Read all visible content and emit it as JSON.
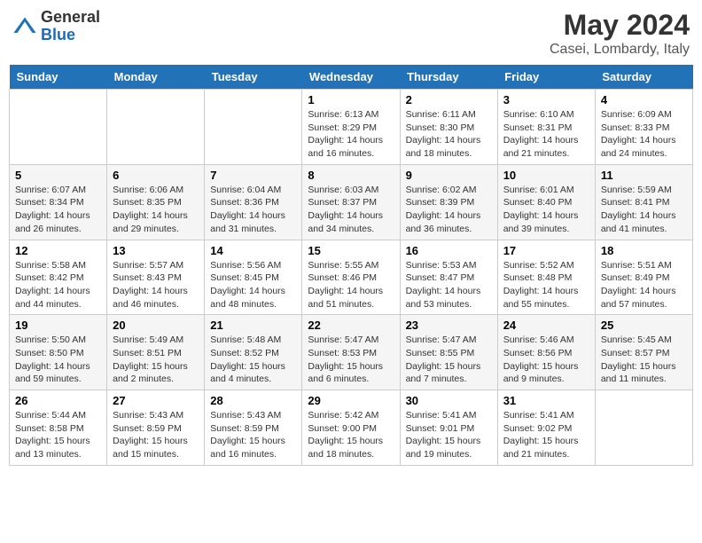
{
  "header": {
    "logo_general": "General",
    "logo_blue": "Blue",
    "month_title": "May 2024",
    "location": "Casei, Lombardy, Italy"
  },
  "days_of_week": [
    "Sunday",
    "Monday",
    "Tuesday",
    "Wednesday",
    "Thursday",
    "Friday",
    "Saturday"
  ],
  "weeks": [
    [
      {
        "day": "",
        "info": ""
      },
      {
        "day": "",
        "info": ""
      },
      {
        "day": "",
        "info": ""
      },
      {
        "day": "1",
        "info": "Sunrise: 6:13 AM\nSunset: 8:29 PM\nDaylight: 14 hours and 16 minutes."
      },
      {
        "day": "2",
        "info": "Sunrise: 6:11 AM\nSunset: 8:30 PM\nDaylight: 14 hours and 18 minutes."
      },
      {
        "day": "3",
        "info": "Sunrise: 6:10 AM\nSunset: 8:31 PM\nDaylight: 14 hours and 21 minutes."
      },
      {
        "day": "4",
        "info": "Sunrise: 6:09 AM\nSunset: 8:33 PM\nDaylight: 14 hours and 24 minutes."
      }
    ],
    [
      {
        "day": "5",
        "info": "Sunrise: 6:07 AM\nSunset: 8:34 PM\nDaylight: 14 hours and 26 minutes."
      },
      {
        "day": "6",
        "info": "Sunrise: 6:06 AM\nSunset: 8:35 PM\nDaylight: 14 hours and 29 minutes."
      },
      {
        "day": "7",
        "info": "Sunrise: 6:04 AM\nSunset: 8:36 PM\nDaylight: 14 hours and 31 minutes."
      },
      {
        "day": "8",
        "info": "Sunrise: 6:03 AM\nSunset: 8:37 PM\nDaylight: 14 hours and 34 minutes."
      },
      {
        "day": "9",
        "info": "Sunrise: 6:02 AM\nSunset: 8:39 PM\nDaylight: 14 hours and 36 minutes."
      },
      {
        "day": "10",
        "info": "Sunrise: 6:01 AM\nSunset: 8:40 PM\nDaylight: 14 hours and 39 minutes."
      },
      {
        "day": "11",
        "info": "Sunrise: 5:59 AM\nSunset: 8:41 PM\nDaylight: 14 hours and 41 minutes."
      }
    ],
    [
      {
        "day": "12",
        "info": "Sunrise: 5:58 AM\nSunset: 8:42 PM\nDaylight: 14 hours and 44 minutes."
      },
      {
        "day": "13",
        "info": "Sunrise: 5:57 AM\nSunset: 8:43 PM\nDaylight: 14 hours and 46 minutes."
      },
      {
        "day": "14",
        "info": "Sunrise: 5:56 AM\nSunset: 8:45 PM\nDaylight: 14 hours and 48 minutes."
      },
      {
        "day": "15",
        "info": "Sunrise: 5:55 AM\nSunset: 8:46 PM\nDaylight: 14 hours and 51 minutes."
      },
      {
        "day": "16",
        "info": "Sunrise: 5:53 AM\nSunset: 8:47 PM\nDaylight: 14 hours and 53 minutes."
      },
      {
        "day": "17",
        "info": "Sunrise: 5:52 AM\nSunset: 8:48 PM\nDaylight: 14 hours and 55 minutes."
      },
      {
        "day": "18",
        "info": "Sunrise: 5:51 AM\nSunset: 8:49 PM\nDaylight: 14 hours and 57 minutes."
      }
    ],
    [
      {
        "day": "19",
        "info": "Sunrise: 5:50 AM\nSunset: 8:50 PM\nDaylight: 14 hours and 59 minutes."
      },
      {
        "day": "20",
        "info": "Sunrise: 5:49 AM\nSunset: 8:51 PM\nDaylight: 15 hours and 2 minutes."
      },
      {
        "day": "21",
        "info": "Sunrise: 5:48 AM\nSunset: 8:52 PM\nDaylight: 15 hours and 4 minutes."
      },
      {
        "day": "22",
        "info": "Sunrise: 5:47 AM\nSunset: 8:53 PM\nDaylight: 15 hours and 6 minutes."
      },
      {
        "day": "23",
        "info": "Sunrise: 5:47 AM\nSunset: 8:55 PM\nDaylight: 15 hours and 7 minutes."
      },
      {
        "day": "24",
        "info": "Sunrise: 5:46 AM\nSunset: 8:56 PM\nDaylight: 15 hours and 9 minutes."
      },
      {
        "day": "25",
        "info": "Sunrise: 5:45 AM\nSunset: 8:57 PM\nDaylight: 15 hours and 11 minutes."
      }
    ],
    [
      {
        "day": "26",
        "info": "Sunrise: 5:44 AM\nSunset: 8:58 PM\nDaylight: 15 hours and 13 minutes."
      },
      {
        "day": "27",
        "info": "Sunrise: 5:43 AM\nSunset: 8:59 PM\nDaylight: 15 hours and 15 minutes."
      },
      {
        "day": "28",
        "info": "Sunrise: 5:43 AM\nSunset: 8:59 PM\nDaylight: 15 hours and 16 minutes."
      },
      {
        "day": "29",
        "info": "Sunrise: 5:42 AM\nSunset: 9:00 PM\nDaylight: 15 hours and 18 minutes."
      },
      {
        "day": "30",
        "info": "Sunrise: 5:41 AM\nSunset: 9:01 PM\nDaylight: 15 hours and 19 minutes."
      },
      {
        "day": "31",
        "info": "Sunrise: 5:41 AM\nSunset: 9:02 PM\nDaylight: 15 hours and 21 minutes."
      },
      {
        "day": "",
        "info": ""
      }
    ]
  ]
}
